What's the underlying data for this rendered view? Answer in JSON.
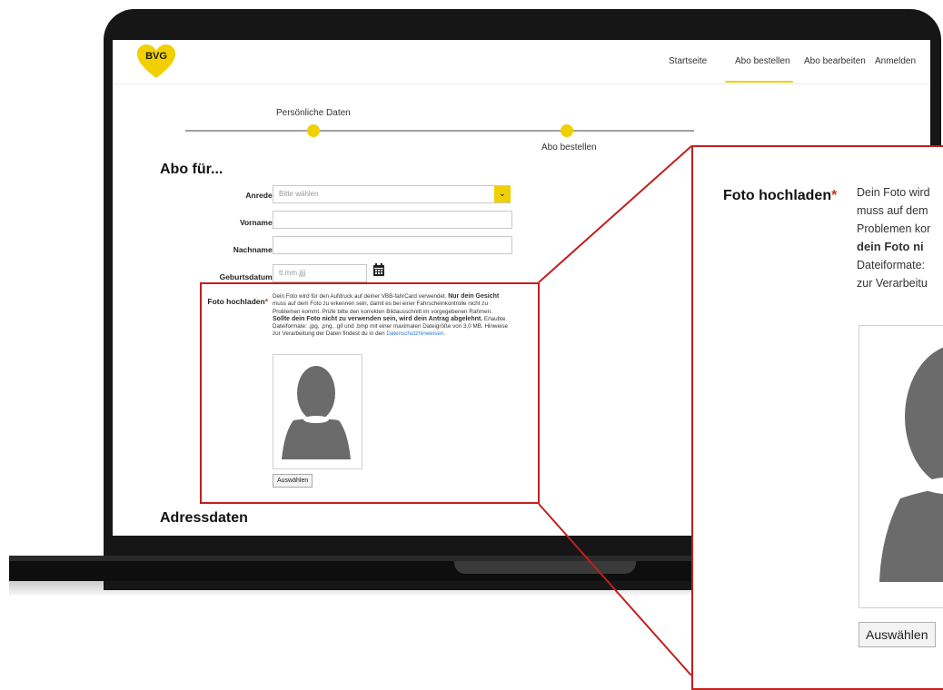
{
  "nav": {
    "items": [
      "Startseite",
      "Abo bestellen",
      "Abo bearbeiten",
      "Anmelden"
    ],
    "active_index": 1
  },
  "brand": {
    "logo_text": "BVG",
    "accent_color": "#f0d000"
  },
  "stepper": {
    "steps": [
      "Persönliche Daten",
      "Abo bestellen"
    ]
  },
  "form": {
    "title": "Abo für...",
    "fields": {
      "anrede": {
        "label": "Anrede",
        "required": "*",
        "placeholder": "Bitte wählen"
      },
      "vorname": {
        "label": "Vorname",
        "required": "*"
      },
      "nachname": {
        "label": "Nachname",
        "required": "*"
      },
      "geburtsdatum": {
        "label": "Geburtsdatum",
        "required": "*",
        "placeholder": "tt.mm.jjjj"
      }
    },
    "photo": {
      "label": "Foto hochladen",
      "required": "*",
      "text_1": "Dein Foto wird für den Aufdruck auf deiner VBB-fahrCard verwendet. ",
      "text_bold_1": "Nur dein Gesicht",
      "text_2": " muss auf dem Foto zu erkennen sein, damit es bei einer Fahrscheinkontrolle nicht zu Problemen kommt. Prüfe bitte den korrekten Bildausschnitt im vorgegebenen Rahmen. ",
      "text_bold_2": "Sollte dein Foto nicht zu verwenden sein, wird dein Antrag abgelehnt.",
      "text_3": " Erlaubte Dateiformate: .jpg, .png, .gif und .bmp mit einer maximalen Dateigröße von 3,0 MB. Hinweise zur Verarbeitung der Daten findest du in den ",
      "link": "Datenschutzhinweisen",
      "text_end": ".",
      "button": "Auswählen"
    },
    "next_section": "Adressdaten"
  },
  "zoom": {
    "title": "Foto hochladen",
    "required": "*",
    "lines": [
      "Dein Foto wird",
      "muss auf dem",
      "Problemen kor",
      "dein Foto ni",
      "Dateiformate:",
      "zur Verarbeitu"
    ],
    "button": "Auswählen"
  }
}
